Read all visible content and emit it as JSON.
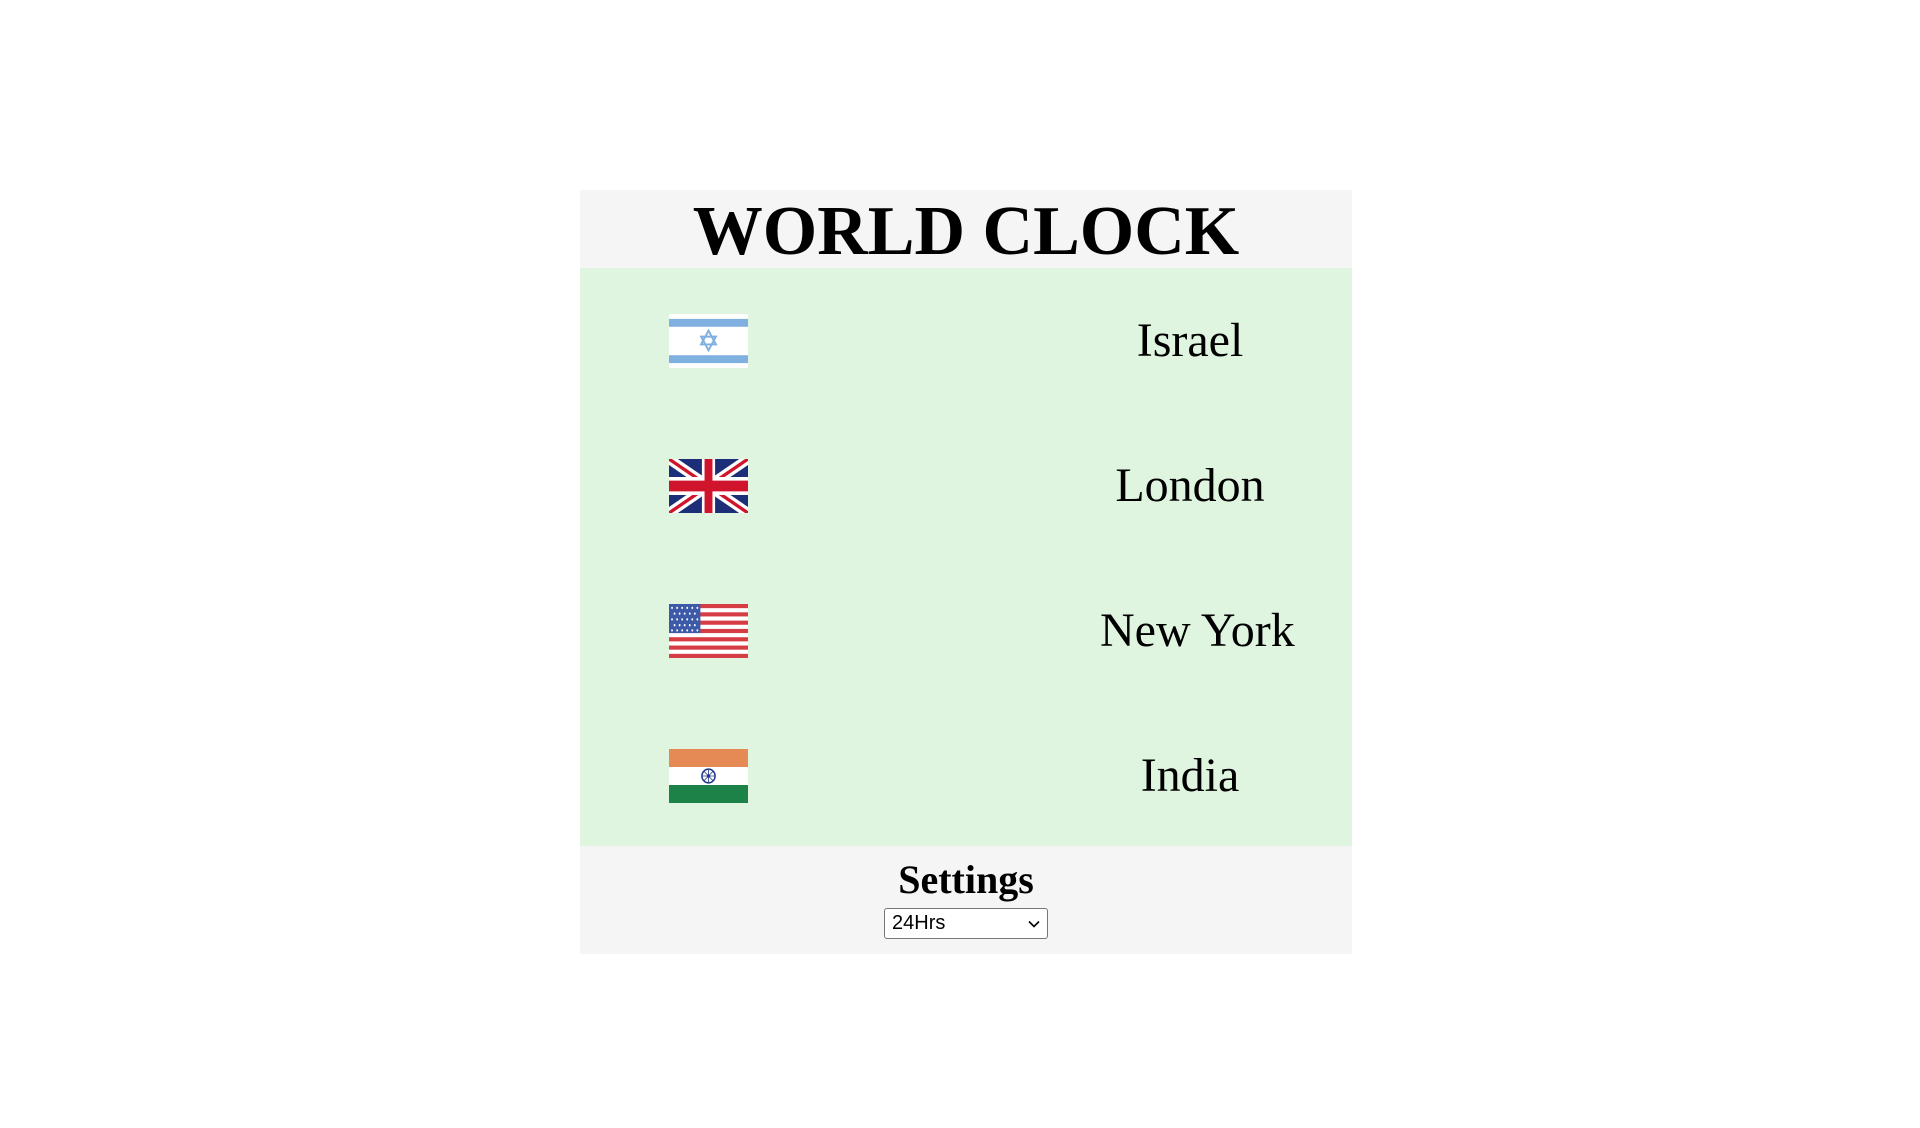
{
  "app": {
    "title": "WORLD CLOCK"
  },
  "clocks": [
    {
      "city": "Israel",
      "flag_icon": "israel-flag-icon"
    },
    {
      "city": "London",
      "flag_icon": "uk-flag-icon"
    },
    {
      "city": "New York",
      "flag_icon": "usa-flag-icon"
    },
    {
      "city": "India",
      "flag_icon": "india-flag-icon"
    }
  ],
  "settings": {
    "label": "Settings",
    "time_format": {
      "selected": "24Hrs",
      "icon": "chevron-down-icon"
    }
  },
  "colors": {
    "header_bg": "#f5f5f5",
    "list_bg": "#dff5df",
    "settings_bg": "#f5f5f5"
  }
}
